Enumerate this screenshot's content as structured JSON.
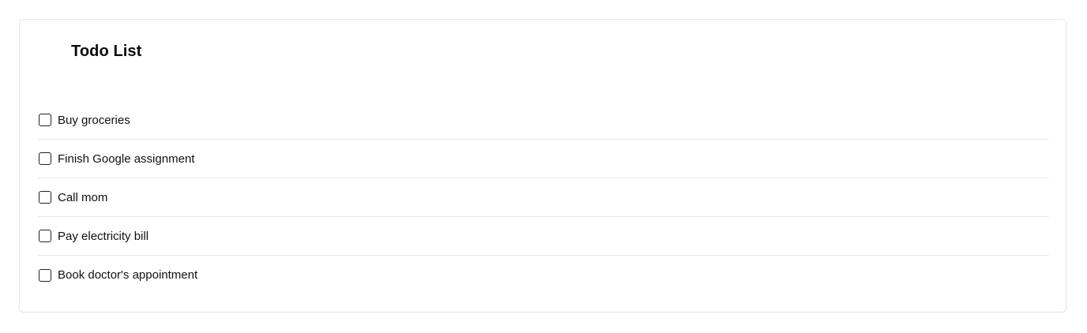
{
  "card": {
    "title": "Todo List"
  },
  "todos": [
    {
      "label": "Buy groceries",
      "checked": false
    },
    {
      "label": "Finish Google assignment",
      "checked": false
    },
    {
      "label": "Call mom",
      "checked": false
    },
    {
      "label": "Pay electricity bill",
      "checked": false
    },
    {
      "label": "Book doctor's appointment",
      "checked": false
    }
  ],
  "colors": {
    "border": "#e5e7eb",
    "text": "#111111",
    "checkbox_border": "#222222"
  }
}
